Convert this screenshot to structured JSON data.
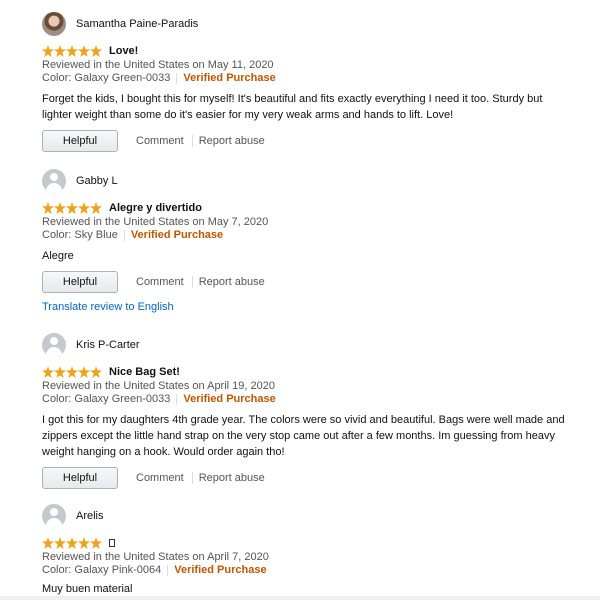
{
  "reviews": [
    {
      "reviewer": "Samantha Paine-Paradis",
      "avatar_type": "photo",
      "rating": 5,
      "title": "Love!",
      "reviewed_on": "Reviewed in the United States on May 11, 2020",
      "color": "Color: Galaxy Green-0033",
      "verified": "Verified Purchase",
      "body": "Forget the kids, I bought this for myself! It's beautiful and fits exactly everything I need it too. Sturdy but lighter weight than some do it's easier for my very weak arms and hands to lift. Love!",
      "helpful_label": "Helpful",
      "comment_label": "Comment",
      "report_label": "Report abuse"
    },
    {
      "reviewer": "Gabby L",
      "avatar_type": "default",
      "rating": 5,
      "title": "Alegre y divertido",
      "reviewed_on": "Reviewed in the United States on May 7, 2020",
      "color": "Color: Sky Blue",
      "verified": "Verified Purchase",
      "body": "Alegre",
      "helpful_label": "Helpful",
      "comment_label": "Comment",
      "report_label": "Report abuse",
      "translate_label": "Translate review to English"
    },
    {
      "reviewer": "Kris P-Carter",
      "avatar_type": "default",
      "rating": 5,
      "title": "Nice Bag Set!",
      "reviewed_on": "Reviewed in the United States on April 19, 2020",
      "color": "Color: Galaxy Green-0033",
      "verified": "Verified Purchase",
      "body": "I got this for my daughters 4th grade year. The colors were so vivid and beautiful. Bags were well made and zippers except the little hand strap on the very stop came out after a few months. Im guessing from heavy weight hanging on a hook. Would order again tho!",
      "helpful_label": "Helpful",
      "comment_label": "Comment",
      "report_label": "Report abuse"
    },
    {
      "reviewer": "Arelis",
      "avatar_type": "default",
      "rating": 5,
      "title": "",
      "reviewed_on": "Reviewed in the United States on April 7, 2020",
      "color": "Color: Galaxy Pink-0064",
      "verified": "Verified Purchase",
      "body": "Muy buen material"
    }
  ],
  "colors": {
    "star": "#f0a318",
    "verified": "#c45500",
    "link": "#0066c0",
    "meta_text": "#555555"
  },
  "icons": {
    "avatar_default": "person-silhouette-icon",
    "star": "star-icon",
    "unknown_glyph": "missing-glyph-box-icon"
  }
}
